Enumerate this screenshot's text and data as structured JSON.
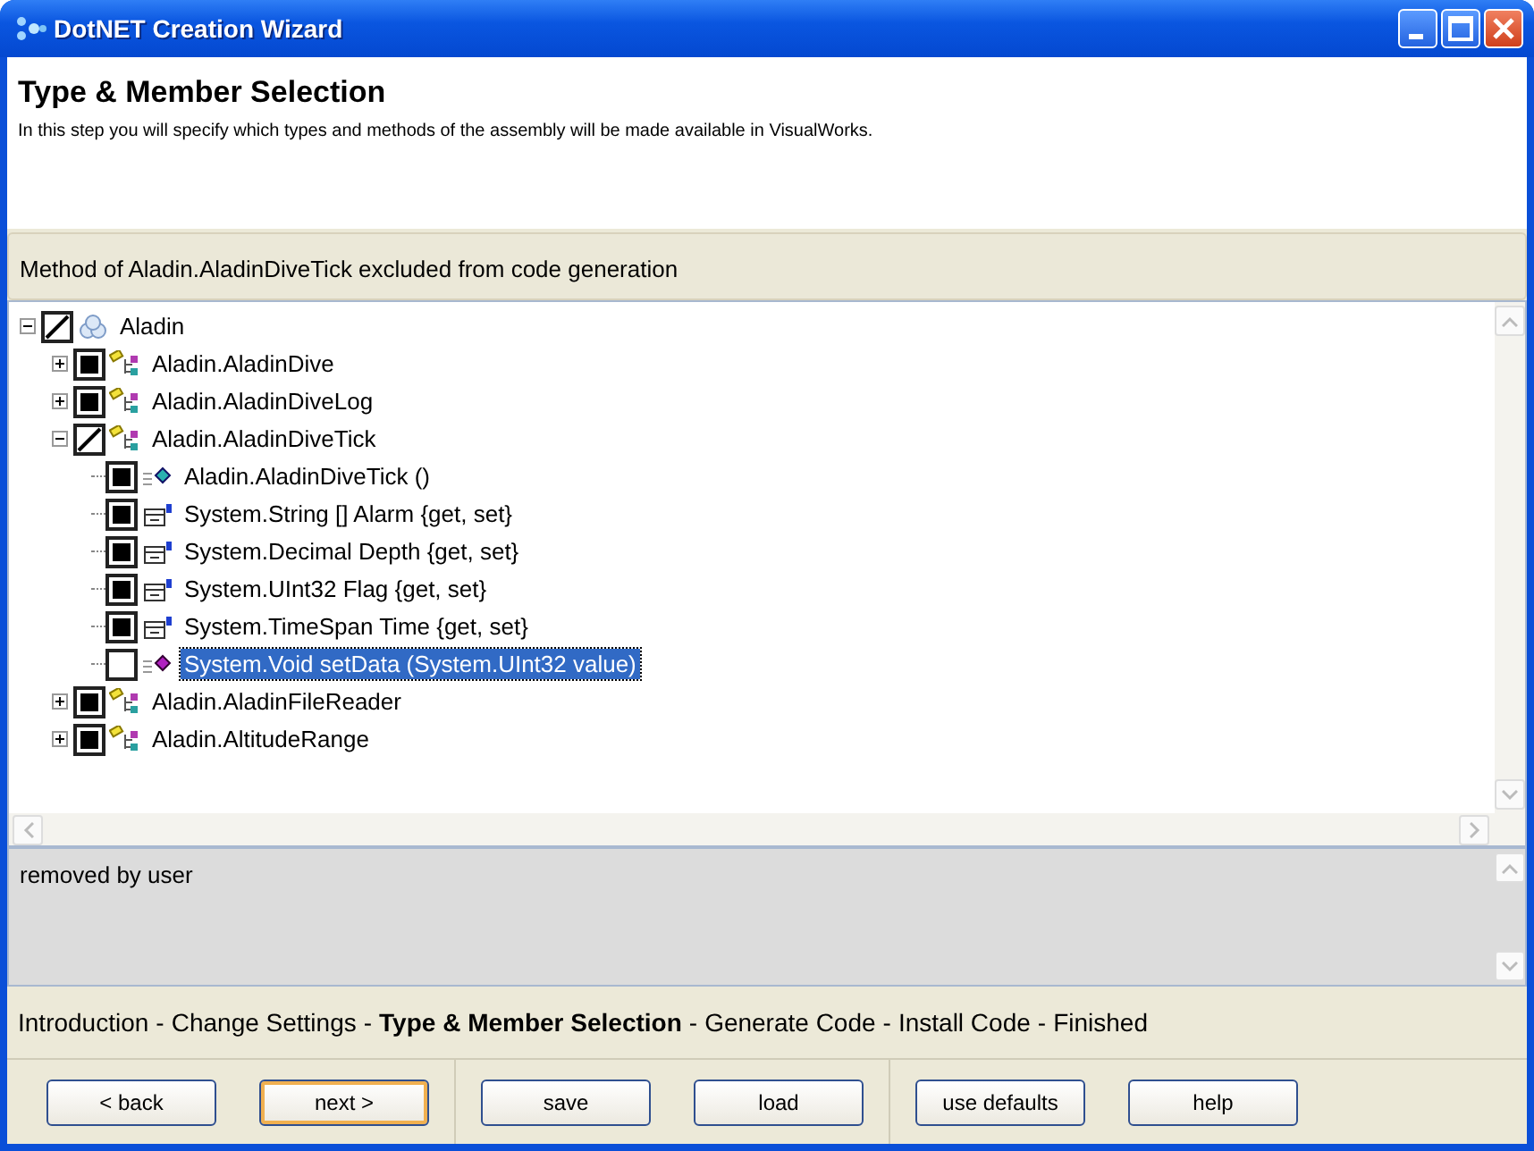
{
  "window": {
    "title": "DotNET Creation Wizard"
  },
  "header": {
    "title": "Type & Member Selection",
    "description": "In this step you will specify which types and methods of the assembly will be made available in VisualWorks."
  },
  "status": "Method of Aladin.AladinDiveTick excluded from code generation",
  "tree": [
    {
      "label": "Aladin",
      "kind": "namespace",
      "partial": true,
      "expanded": true,
      "selected": false,
      "children": [
        {
          "label": "Aladin.AladinDive",
          "kind": "class",
          "checked": true,
          "partial": false,
          "expanded": false,
          "selected": false
        },
        {
          "label": "Aladin.AladinDiveLog",
          "kind": "class",
          "checked": true,
          "partial": false,
          "expanded": false,
          "selected": false
        },
        {
          "label": "Aladin.AladinDiveTick",
          "kind": "class",
          "partial": true,
          "expanded": true,
          "selected": false,
          "children": [
            {
              "label": "Aladin.AladinDiveTick  ()",
              "kind": "constructor",
              "checked": true,
              "partial": false,
              "selected": false
            },
            {
              "label": "System.String [] Alarm {get, set}",
              "kind": "property",
              "checked": true,
              "partial": false,
              "selected": false
            },
            {
              "label": "System.Decimal  Depth {get, set}",
              "kind": "property",
              "checked": true,
              "partial": false,
              "selected": false
            },
            {
              "label": "System.UInt32  Flag {get, set}",
              "kind": "property",
              "checked": true,
              "partial": false,
              "selected": false
            },
            {
              "label": "System.TimeSpan  Time {get, set}",
              "kind": "property",
              "checked": true,
              "partial": false,
              "selected": false
            },
            {
              "label": "System.Void  setData (System.UInt32 value)",
              "kind": "method",
              "checked": false,
              "partial": false,
              "selected": true
            }
          ]
        },
        {
          "label": "Aladin.AladinFileReader",
          "kind": "class",
          "checked": true,
          "partial": false,
          "expanded": false,
          "selected": false
        },
        {
          "label": "Aladin.AltitudeRange",
          "kind": "class",
          "checked": true,
          "partial": false,
          "expanded": false,
          "selected": false
        }
      ]
    }
  ],
  "info": "removed by user",
  "steps": [
    {
      "kind": "step",
      "label": "Introduction",
      "selected": false
    },
    {
      "kind": "separator",
      "label": "-"
    },
    {
      "kind": "step",
      "label": "Change Settings",
      "selected": false
    },
    {
      "kind": "separator",
      "label": "-"
    },
    {
      "kind": "step",
      "label": "Type & Member Selection",
      "selected": true
    },
    {
      "kind": "separator",
      "label": "-"
    },
    {
      "kind": "step",
      "label": "Generate Code",
      "selected": false
    },
    {
      "kind": "separator",
      "label": "-"
    },
    {
      "kind": "step",
      "label": "Install Code",
      "selected": false
    },
    {
      "kind": "separator",
      "label": "-"
    },
    {
      "kind": "step",
      "label": "Finished",
      "selected": false
    }
  ],
  "button_groups": [
    [
      {
        "label": "< back",
        "kind": "normal"
      },
      {
        "label": "next >",
        "kind": "default"
      }
    ],
    [
      {
        "label": "save",
        "kind": "normal"
      },
      {
        "label": "load",
        "kind": "normal"
      }
    ],
    [
      {
        "label": "use defaults",
        "kind": "normal"
      },
      {
        "label": "help",
        "kind": "normal"
      }
    ]
  ]
}
